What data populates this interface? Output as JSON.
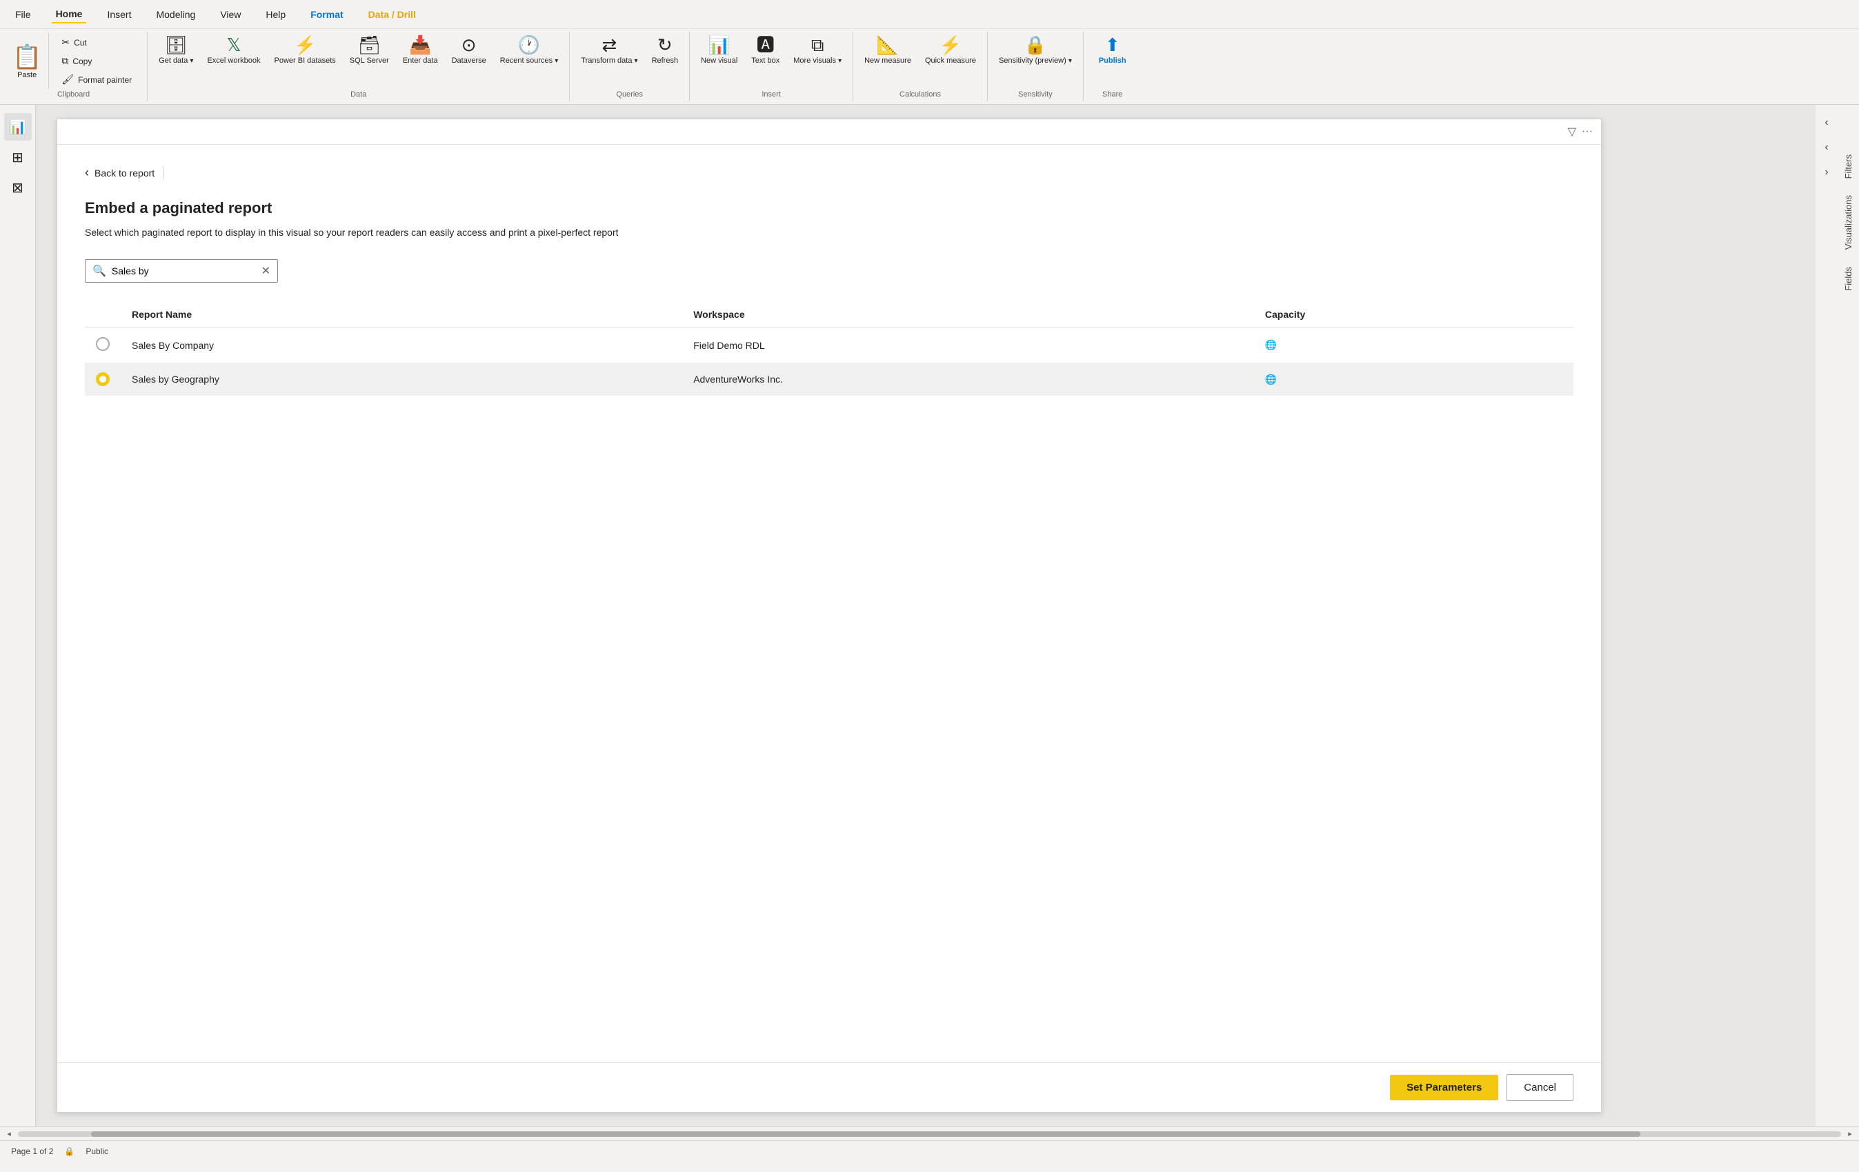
{
  "menu": {
    "items": [
      {
        "id": "file",
        "label": "File"
      },
      {
        "id": "home",
        "label": "Home",
        "active": true
      },
      {
        "id": "insert",
        "label": "Insert"
      },
      {
        "id": "modeling",
        "label": "Modeling"
      },
      {
        "id": "view",
        "label": "View"
      },
      {
        "id": "help",
        "label": "Help"
      },
      {
        "id": "format",
        "label": "Format",
        "special": "format"
      },
      {
        "id": "datadrill",
        "label": "Data / Drill",
        "special": "datadrill"
      }
    ]
  },
  "ribbon": {
    "clipboard": {
      "label": "Clipboard",
      "paste": "Paste",
      "cut": "Cut",
      "copy": "Copy",
      "format_painter": "Format painter"
    },
    "data": {
      "label": "Data",
      "get_data": "Get data",
      "excel_workbook": "Excel workbook",
      "power_bi_datasets": "Power BI datasets",
      "sql_server": "SQL Server",
      "enter_data": "Enter data",
      "dataverse": "Dataverse",
      "recent_sources": "Recent sources"
    },
    "queries": {
      "label": "Queries",
      "transform_data": "Transform data",
      "refresh": "Refresh"
    },
    "insert": {
      "label": "Insert",
      "new_visual": "New visual",
      "text_box": "Text box",
      "more_visuals": "More visuals"
    },
    "calculations": {
      "label": "Calculations",
      "new_measure": "New measure",
      "quick_measure": "Quick measure"
    },
    "sensitivity": {
      "label": "Sensitivity",
      "sensitivity_preview": "Sensitivity (preview)"
    },
    "share": {
      "label": "Share",
      "publish": "Publish"
    }
  },
  "modal": {
    "back_label": "Back to report",
    "title": "Embed a paginated report",
    "subtitle": "Select which paginated report to display in this visual so your report readers can easily access and print a pixel-perfect report",
    "search_placeholder": "Sales by",
    "search_value": "Sales by",
    "table": {
      "columns": [
        "",
        "Report Name",
        "Workspace",
        "Capacity"
      ],
      "rows": [
        {
          "id": 1,
          "selected": false,
          "report_name": "Sales By Company",
          "workspace": "Field Demo RDL",
          "capacity_icon": "🌐"
        },
        {
          "id": 2,
          "selected": true,
          "report_name": "Sales by Geography",
          "workspace": "AdventureWorks Inc.",
          "capacity_icon": "🌐"
        }
      ]
    },
    "set_parameters_btn": "Set Parameters",
    "cancel_btn": "Cancel"
  },
  "right_panel": {
    "filters_label": "Filters",
    "visualizations_label": "Visualizations",
    "fields_label": "Fields"
  },
  "status_bar": {
    "page": "Page 1 of 2",
    "visibility": "Public"
  },
  "left_sidebar": {
    "icons": [
      {
        "id": "report",
        "symbol": "📊"
      },
      {
        "id": "data",
        "symbol": "🗃"
      },
      {
        "id": "model",
        "symbol": "⊞"
      }
    ]
  }
}
